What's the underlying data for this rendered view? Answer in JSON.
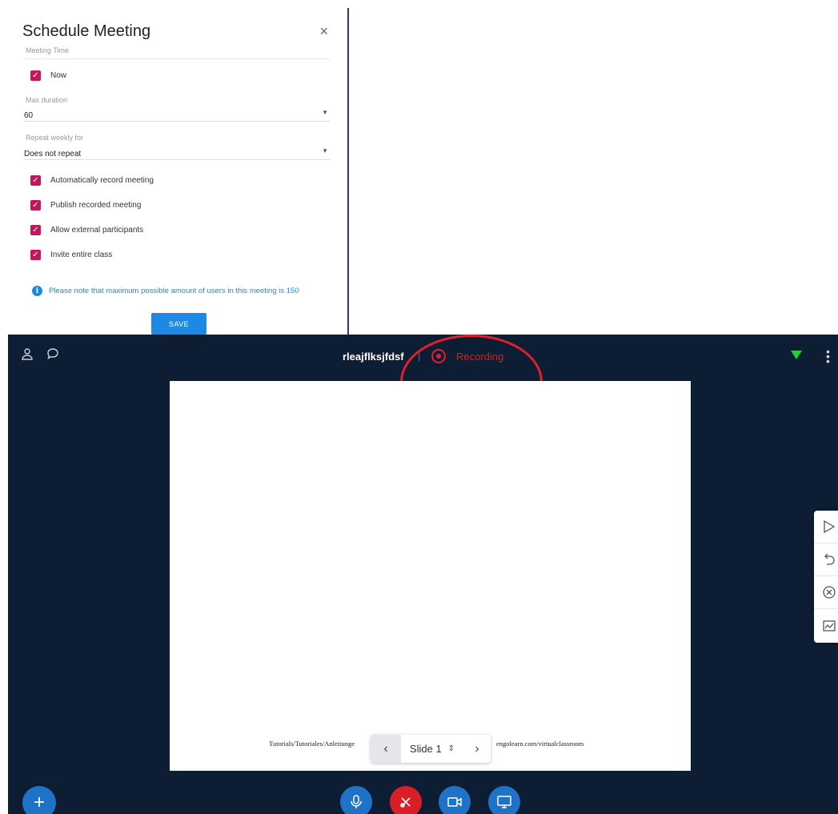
{
  "dialog": {
    "title": "Schedule Meeting",
    "close_glyph": "×",
    "meeting_time_label": "Meeting Time",
    "now_label": "Now",
    "max_duration_label": "Max duration",
    "max_duration_value": "60",
    "repeat_label": "Repeat weekly for",
    "repeat_value": "Does not repeat",
    "options": [
      {
        "label": "Automatically record meeting",
        "checked": true
      },
      {
        "label": "Publish recorded meeting",
        "checked": true
      },
      {
        "label": "Allow external participants",
        "checked": true
      },
      {
        "label": "Invite entire class",
        "checked": true
      }
    ],
    "info_text": "Please note that maximum possible amount of users in this meeting is 150",
    "save_label": "SAVE",
    "accent_color": "#c2185b",
    "primary_color": "#1e88e5"
  },
  "classroom": {
    "meeting_name": "rleajflksjfdsf",
    "separator": "|",
    "recording_label": "Recording",
    "recording_color": "#d81e28",
    "background_color": "#0d1d33",
    "slide": {
      "footer_left": "Tutorials/Tutoriales/Anleitunge",
      "footer_right": "engolearn.com/virtualclassroom"
    },
    "slide_nav": {
      "current": "Slide 1"
    },
    "top_icons": [
      "user-icon",
      "chat-icon",
      "signal-icon",
      "more-vert-icon"
    ],
    "tools": [
      "pointer-icon",
      "undo-icon",
      "clear-icon",
      "whiteboard-icon"
    ],
    "controls": [
      "add-icon",
      "mic-icon",
      "hangup-icon",
      "camera-icon",
      "screen-share-icon"
    ]
  }
}
